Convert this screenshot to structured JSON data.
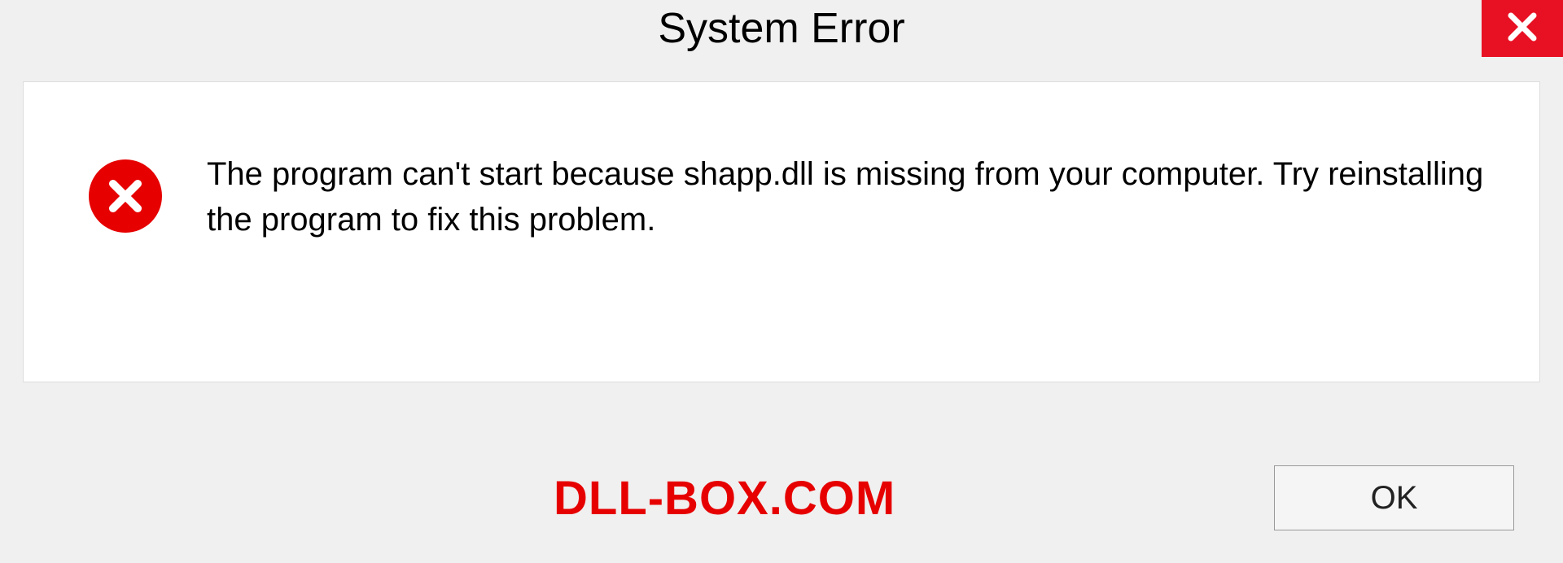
{
  "title": "System Error",
  "message": "The program can't start because shapp.dll is missing from your computer. Try reinstalling the program to fix this problem.",
  "watermark": "DLL-BOX.COM",
  "ok_label": "OK"
}
